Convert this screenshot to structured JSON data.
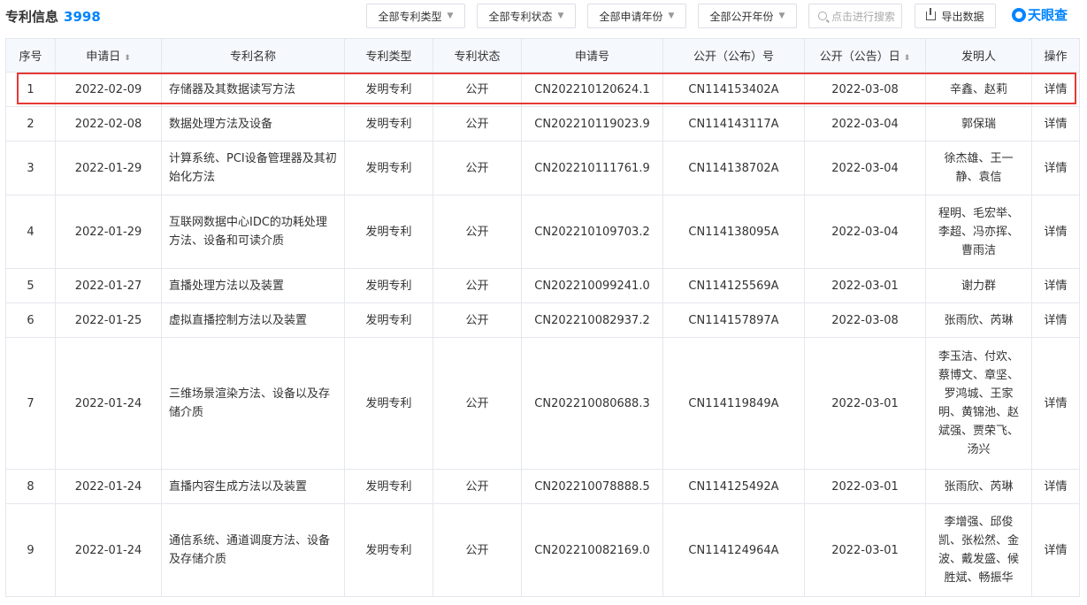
{
  "header": {
    "title": "专利信息",
    "count": "3998",
    "filters": [
      "全部专利类型",
      "全部专利状态",
      "全部申请年份",
      "全部公开年份"
    ],
    "search_placeholder": "点击进行搜索",
    "export_label": "导出数据",
    "logo_text": "天眼查"
  },
  "table": {
    "columns": [
      "序号",
      "申请日",
      "专利名称",
      "专利类型",
      "专利状态",
      "申请号",
      "公开（公布）号",
      "公开（公告）日",
      "发明人",
      "操作"
    ],
    "rows": [
      {
        "no": "1",
        "date": "2022-02-09",
        "name": "存储器及其数据读写方法",
        "type": "发明专利",
        "status": "公开",
        "app_no": "CN202210120624.1",
        "pub_no": "CN114153402A",
        "pub_date": "2022-03-08",
        "inventors": "辛鑫、赵莉",
        "action": "详情"
      },
      {
        "no": "2",
        "date": "2022-02-08",
        "name": "数据处理方法及设备",
        "type": "发明专利",
        "status": "公开",
        "app_no": "CN202210119023.9",
        "pub_no": "CN114143117A",
        "pub_date": "2022-03-04",
        "inventors": "郭保瑞",
        "action": "详情"
      },
      {
        "no": "3",
        "date": "2022-01-29",
        "name": "计算系统、PCI设备管理器及其初始化方法",
        "type": "发明专利",
        "status": "公开",
        "app_no": "CN202210111761.9",
        "pub_no": "CN114138702A",
        "pub_date": "2022-03-04",
        "inventors": "徐杰雄、王一静、袁信",
        "action": "详情"
      },
      {
        "no": "4",
        "date": "2022-01-29",
        "name": "互联网数据中心IDC的功耗处理方法、设备和可读介质",
        "type": "发明专利",
        "status": "公开",
        "app_no": "CN202210109703.2",
        "pub_no": "CN114138095A",
        "pub_date": "2022-03-04",
        "inventors": "程明、毛宏举、李超、冯亦挥、曹雨洁",
        "action": "详情"
      },
      {
        "no": "5",
        "date": "2022-01-27",
        "name": "直播处理方法以及装置",
        "type": "发明专利",
        "status": "公开",
        "app_no": "CN202210099241.0",
        "pub_no": "CN114125569A",
        "pub_date": "2022-03-01",
        "inventors": "谢力群",
        "action": "详情"
      },
      {
        "no": "6",
        "date": "2022-01-25",
        "name": "虚拟直播控制方法以及装置",
        "type": "发明专利",
        "status": "公开",
        "app_no": "CN202210082937.2",
        "pub_no": "CN114157897A",
        "pub_date": "2022-03-08",
        "inventors": "张雨欣、芮琳",
        "action": "详情"
      },
      {
        "no": "7",
        "date": "2022-01-24",
        "name": "三维场景渲染方法、设备以及存储介质",
        "type": "发明专利",
        "status": "公开",
        "app_no": "CN202210080688.3",
        "pub_no": "CN114119849A",
        "pub_date": "2022-03-01",
        "inventors": "李玉洁、付欢、蔡博文、章坚、罗鸿城、王家明、黄锦池、赵斌强、贾荣飞、汤兴",
        "action": "详情"
      },
      {
        "no": "8",
        "date": "2022-01-24",
        "name": "直播内容生成方法以及装置",
        "type": "发明专利",
        "status": "公开",
        "app_no": "CN202210078888.5",
        "pub_no": "CN114125492A",
        "pub_date": "2022-03-01",
        "inventors": "张雨欣、芮琳",
        "action": "详情"
      },
      {
        "no": "9",
        "date": "2022-01-24",
        "name": "通信系统、通道调度方法、设备及存储介质",
        "type": "发明专利",
        "status": "公开",
        "app_no": "CN202210082169.0",
        "pub_no": "CN114124964A",
        "pub_date": "2022-03-01",
        "inventors": "李增强、邱俊凯、张松然、金波、戴发盛、候胜斌、畅振华",
        "action": "详情"
      }
    ]
  },
  "colors": {
    "accent": "#0084ff",
    "status": "#9b59b6",
    "highlight": "#e53935",
    "header_bg": "#f5f8fc"
  }
}
